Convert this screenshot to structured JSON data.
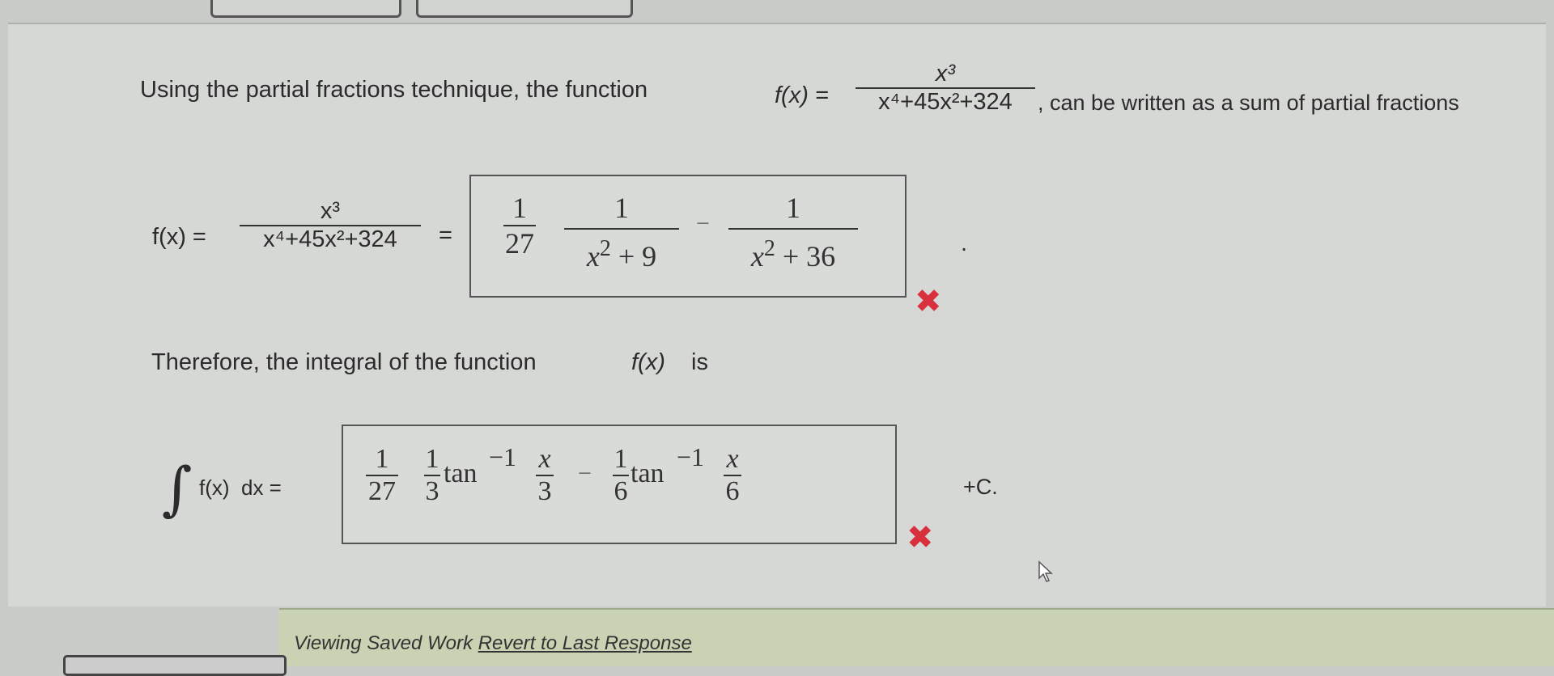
{
  "intro": {
    "prefix": "Using the partial fractions technique, the function",
    "fx": "f(x) =",
    "numerator": "x³",
    "denominator": "x⁴+45x²+324",
    "suffix": ", can be written as a sum of partial fractions"
  },
  "decomposition": {
    "fx": "f(x) =",
    "numerator": "x³",
    "denominator": "x⁴+45x²+324",
    "equals": "=",
    "answer": {
      "coef_num": "1",
      "coef_den": "27",
      "term1_num": "1",
      "term1_den_x": "x",
      "term1_den_exp": "2",
      "term1_den_rest": "+ 9",
      "minus": "−",
      "term2_num": "1",
      "term2_den_x": "x",
      "term2_den_exp": "2",
      "term2_den_rest": "+ 36"
    },
    "period": "."
  },
  "therefore": {
    "text": "Therefore, the integral of the function",
    "fx": "f(x)",
    "is": "is"
  },
  "integral": {
    "sign": "∫",
    "label": "f(x)  dx =",
    "answer": {
      "coef_num": "1",
      "coef_den": "27",
      "t1_num": "1",
      "t1_den": "3",
      "tan": "tan",
      "exp": "−1",
      "arg1_num": "x",
      "arg1_den": "3",
      "minus": "−",
      "t2_num": "1",
      "t2_den": "6",
      "arg2_num": "x",
      "arg2_den": "6"
    },
    "constant": "+C."
  },
  "marks": {
    "wrong": "✖"
  },
  "footer": {
    "viewing": "Viewing Saved Work",
    "revert": "Revert to Last Response"
  },
  "colors": {
    "incorrect": "#d8303d",
    "footer_bg": "#c9d2b2"
  }
}
